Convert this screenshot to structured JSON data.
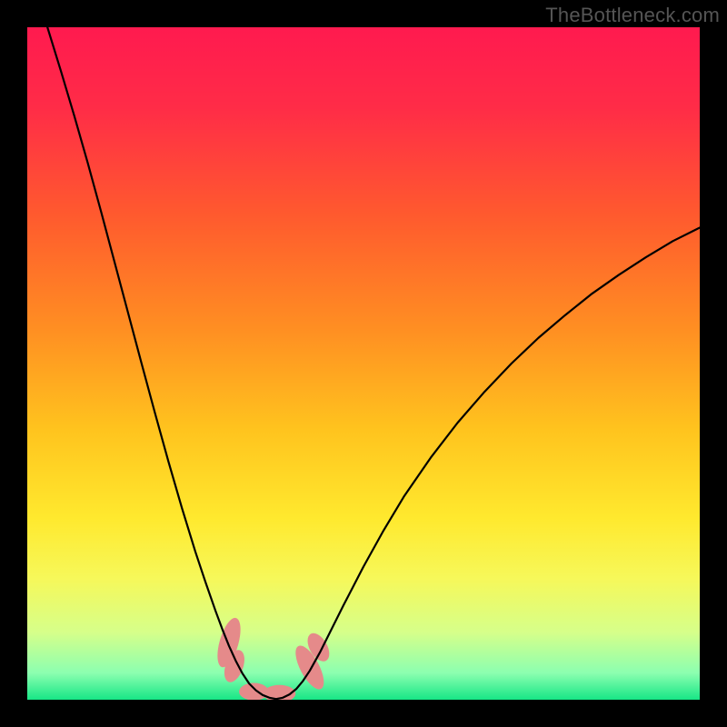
{
  "attribution": "TheBottleneck.com",
  "chart_data": {
    "type": "line",
    "title": "",
    "xlabel": "",
    "ylabel": "",
    "xlim": [
      0,
      100
    ],
    "ylim": [
      0,
      100
    ],
    "background_gradient": {
      "stops": [
        {
          "offset": 0.0,
          "color": "#ff1a4f"
        },
        {
          "offset": 0.12,
          "color": "#ff2c47"
        },
        {
          "offset": 0.28,
          "color": "#ff5a2e"
        },
        {
          "offset": 0.45,
          "color": "#ff8f22"
        },
        {
          "offset": 0.6,
          "color": "#ffc41e"
        },
        {
          "offset": 0.73,
          "color": "#ffe92e"
        },
        {
          "offset": 0.82,
          "color": "#f6f85a"
        },
        {
          "offset": 0.9,
          "color": "#d6ff8a"
        },
        {
          "offset": 0.96,
          "color": "#8cffb0"
        },
        {
          "offset": 1.0,
          "color": "#17e686"
        }
      ]
    },
    "series": [
      {
        "name": "bottleneck-curve",
        "color": "#000000",
        "width": 2.2,
        "data": [
          {
            "x": 3.0,
            "y": 100.0
          },
          {
            "x": 5.0,
            "y": 93.5
          },
          {
            "x": 7.0,
            "y": 86.8
          },
          {
            "x": 9.0,
            "y": 79.8
          },
          {
            "x": 11.0,
            "y": 72.5
          },
          {
            "x": 13.0,
            "y": 65.0
          },
          {
            "x": 15.0,
            "y": 57.5
          },
          {
            "x": 17.0,
            "y": 50.0
          },
          {
            "x": 19.0,
            "y": 42.6
          },
          {
            "x": 21.0,
            "y": 35.4
          },
          {
            "x": 23.0,
            "y": 28.5
          },
          {
            "x": 25.0,
            "y": 22.0
          },
          {
            "x": 26.5,
            "y": 17.5
          },
          {
            "x": 28.0,
            "y": 13.2
          },
          {
            "x": 29.0,
            "y": 10.5
          },
          {
            "x": 30.0,
            "y": 8.0
          },
          {
            "x": 31.0,
            "y": 5.8
          },
          {
            "x": 32.0,
            "y": 3.9
          },
          {
            "x": 33.0,
            "y": 2.4
          },
          {
            "x": 34.0,
            "y": 1.4
          },
          {
            "x": 35.0,
            "y": 0.7
          },
          {
            "x": 36.0,
            "y": 0.3
          },
          {
            "x": 37.0,
            "y": 0.1
          },
          {
            "x": 38.0,
            "y": 0.3
          },
          {
            "x": 39.0,
            "y": 0.8
          },
          {
            "x": 40.0,
            "y": 1.6
          },
          {
            "x": 41.0,
            "y": 2.8
          },
          {
            "x": 42.0,
            "y": 4.3
          },
          {
            "x": 43.5,
            "y": 7.0
          },
          {
            "x": 45.0,
            "y": 10.0
          },
          {
            "x": 47.0,
            "y": 14.0
          },
          {
            "x": 50.0,
            "y": 19.8
          },
          {
            "x": 53.0,
            "y": 25.2
          },
          {
            "x": 56.0,
            "y": 30.2
          },
          {
            "x": 60.0,
            "y": 36.0
          },
          {
            "x": 64.0,
            "y": 41.2
          },
          {
            "x": 68.0,
            "y": 45.8
          },
          {
            "x": 72.0,
            "y": 50.0
          },
          {
            "x": 76.0,
            "y": 53.8
          },
          {
            "x": 80.0,
            "y": 57.2
          },
          {
            "x": 84.0,
            "y": 60.4
          },
          {
            "x": 88.0,
            "y": 63.2
          },
          {
            "x": 92.0,
            "y": 65.8
          },
          {
            "x": 96.0,
            "y": 68.2
          },
          {
            "x": 100.0,
            "y": 70.2
          }
        ]
      }
    ],
    "markers": [
      {
        "name": "highlight-blobs",
        "color": "#e58a8a",
        "segments": [
          {
            "cx": 30.0,
            "cy": 8.5,
            "rx": 1.4,
            "ry": 3.8,
            "rot": 16
          },
          {
            "cx": 30.8,
            "cy": 5.0,
            "rx": 1.3,
            "ry": 2.5,
            "rot": 20
          },
          {
            "cx": 33.7,
            "cy": 1.2,
            "rx": 2.2,
            "ry": 1.3,
            "rot": 0
          },
          {
            "cx": 37.5,
            "cy": 0.9,
            "rx": 2.4,
            "ry": 1.3,
            "rot": 0
          },
          {
            "cx": 42.0,
            "cy": 4.8,
            "rx": 1.4,
            "ry": 3.6,
            "rot": -28
          },
          {
            "cx": 43.3,
            "cy": 7.8,
            "rx": 1.3,
            "ry": 2.3,
            "rot": -30
          }
        ]
      }
    ]
  }
}
